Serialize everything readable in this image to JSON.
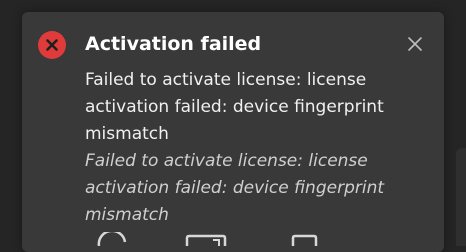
{
  "toast": {
    "status_icon": "error-x-circle-icon",
    "title": "Activation failed",
    "close_icon": "close-x-icon",
    "message": "Failed to activate license: license activation failed: device fingerprint mismatch",
    "detail": "Failed to activate license: license activation failed: device fingerprint mismatch"
  },
  "colors": {
    "background": "#252525",
    "toast_background": "#393939",
    "error_red": "#e03b3b",
    "title_text": "#ffffff",
    "message_text": "#f0f0f0",
    "detail_text": "#cfcfcf"
  },
  "partially_visible_icons": [
    "refresh-icon",
    "device-icon",
    "document-icon"
  ]
}
